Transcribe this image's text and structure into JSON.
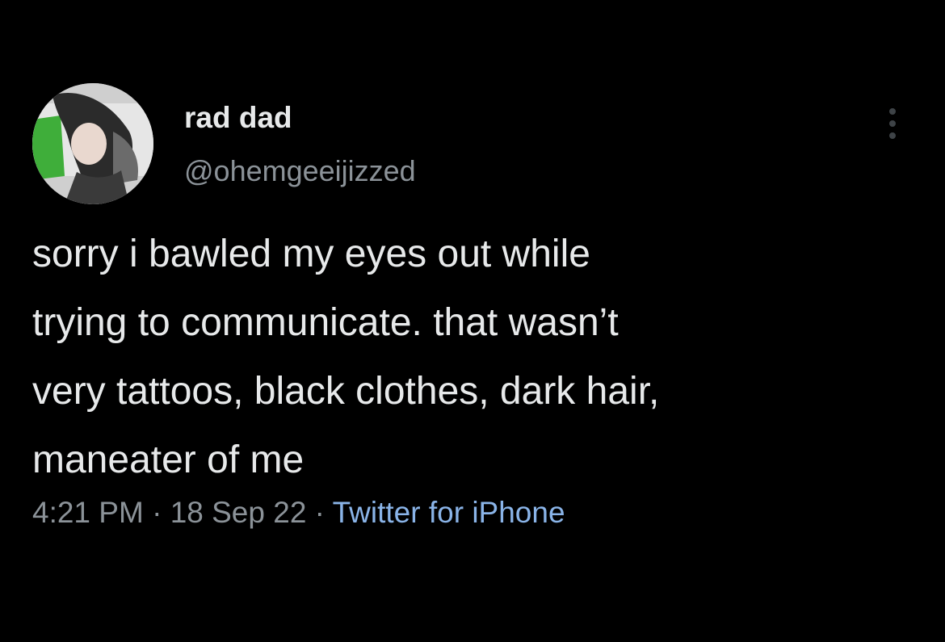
{
  "tweet": {
    "display_name": "rad dad",
    "handle": "@ohemgeeijizzed",
    "text": "sorry i bawled my eyes out while\ntrying to communicate. that wasn’t\nvery tattoos, black clothes, dark hair,\nmaneater of me",
    "time": "4:21 PM",
    "separator": " · ",
    "date": "18 Sep 22",
    "source": "Twitter for iPhone"
  },
  "icons": {
    "more": "more-horizontal-icon",
    "avatar": "profile-photo"
  },
  "colors": {
    "background": "#000000",
    "primary_text": "#e7e9ea",
    "secondary_text": "#8b9298",
    "link": "#8ab4e8"
  }
}
